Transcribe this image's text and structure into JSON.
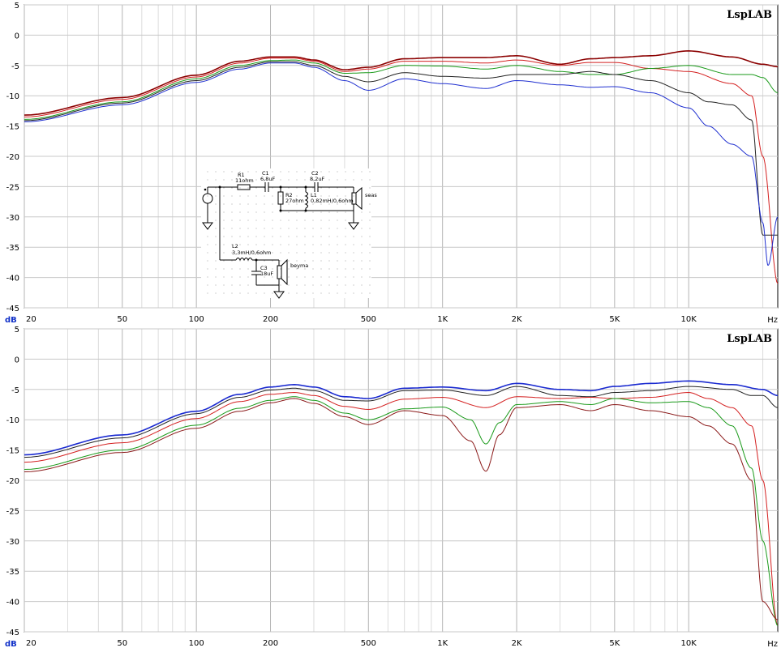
{
  "chart_data": [
    {
      "type": "line",
      "title": "LspLAB",
      "xlabel": "Hz",
      "ylabel": "dB",
      "xscale": "log",
      "xlim": [
        20,
        23000
      ],
      "ylim": [
        -45,
        5
      ],
      "x_ticks": [
        20,
        50,
        100,
        200,
        500,
        1000,
        2000,
        5000,
        10000
      ],
      "x_tick_labels": [
        "20",
        "50",
        "100",
        "200",
        "500",
        "1K",
        "2K",
        "5K",
        "10K"
      ],
      "y_ticks": [
        5,
        0,
        -5,
        -10,
        -15,
        -20,
        -25,
        -30,
        -35,
        -40,
        -45
      ],
      "grid": true,
      "series": [
        {
          "color": "#8b0000",
          "x": [
            20,
            50,
            100,
            150,
            200,
            250,
            300,
            400,
            500,
            700,
            1000,
            1500,
            2000,
            3000,
            4000,
            5000,
            7000,
            10000,
            15000,
            20000,
            23000
          ],
          "y": [
            -13.2,
            -10.3,
            -6.6,
            -4.3,
            -3.6,
            -3.6,
            -4.1,
            -5.7,
            -5.3,
            -3.9,
            -3.7,
            -3.7,
            -3.4,
            -4.8,
            -3.9,
            -3.7,
            -3.4,
            -2.6,
            -3.6,
            -4.8,
            -5.2
          ]
        },
        {
          "color": "#d42020",
          "x": [
            20,
            50,
            100,
            150,
            200,
            250,
            300,
            400,
            500,
            700,
            1000,
            1500,
            2000,
            3000,
            4000,
            5000,
            7000,
            10000,
            15000,
            18000,
            20000,
            23000
          ],
          "y": [
            -13.5,
            -10.6,
            -6.9,
            -4.6,
            -3.8,
            -3.8,
            -4.3,
            -6.0,
            -5.6,
            -4.3,
            -4.3,
            -4.6,
            -4.1,
            -5.0,
            -4.5,
            -4.5,
            -5.5,
            -6.0,
            -8.0,
            -10.0,
            -20.0,
            -41.0
          ]
        },
        {
          "color": "#1a9a1a",
          "x": [
            20,
            50,
            100,
            150,
            200,
            250,
            300,
            400,
            500,
            700,
            1000,
            1500,
            2000,
            3000,
            4000,
            5000,
            7000,
            10000,
            15000,
            18000,
            20000,
            23000
          ],
          "y": [
            -13.9,
            -11.0,
            -7.2,
            -5.0,
            -4.2,
            -4.1,
            -4.6,
            -6.3,
            -6.2,
            -5.0,
            -5.1,
            -5.6,
            -5.0,
            -6.0,
            -6.5,
            -6.5,
            -5.5,
            -5.0,
            -6.5,
            -6.5,
            -7.0,
            -9.5
          ]
        },
        {
          "color": "#222222",
          "x": [
            20,
            50,
            100,
            150,
            200,
            250,
            300,
            400,
            500,
            700,
            1000,
            1500,
            2000,
            3000,
            4000,
            5000,
            7000,
            10000,
            12000,
            15000,
            18000,
            20000,
            23000
          ],
          "y": [
            -14.1,
            -11.2,
            -7.5,
            -5.3,
            -4.4,
            -4.4,
            -5.0,
            -6.8,
            -7.7,
            -6.2,
            -6.8,
            -7.1,
            -6.5,
            -6.5,
            -6.0,
            -6.5,
            -7.5,
            -9.5,
            -11.0,
            -11.5,
            -14.0,
            -33.0,
            -33.0
          ]
        },
        {
          "color": "#2030d0",
          "x": [
            20,
            50,
            100,
            150,
            200,
            250,
            300,
            400,
            500,
            700,
            1000,
            1500,
            2000,
            3000,
            4000,
            5000,
            7000,
            10000,
            12000,
            15000,
            18000,
            20000,
            21000,
            23000
          ],
          "y": [
            -14.3,
            -11.5,
            -7.8,
            -5.6,
            -4.6,
            -4.6,
            -5.3,
            -7.5,
            -9.1,
            -7.2,
            -8.0,
            -8.8,
            -7.5,
            -8.2,
            -8.6,
            -8.5,
            -9.5,
            -12.0,
            -15.0,
            -18.0,
            -20.0,
            -31.0,
            -38.0,
            -30.0
          ]
        }
      ]
    },
    {
      "type": "line",
      "title": "LspLAB",
      "xlabel": "Hz",
      "ylabel": "dB",
      "xscale": "log",
      "xlim": [
        20,
        23000
      ],
      "ylim": [
        -45,
        5
      ],
      "x_ticks": [
        20,
        50,
        100,
        200,
        500,
        1000,
        2000,
        5000,
        10000
      ],
      "x_tick_labels": [
        "20",
        "50",
        "100",
        "200",
        "500",
        "1K",
        "2K",
        "5K",
        "10K"
      ],
      "y_ticks": [
        5,
        0,
        -5,
        -10,
        -15,
        -20,
        -25,
        -30,
        -35,
        -40,
        -45
      ],
      "grid": true,
      "series": [
        {
          "color": "#1a2ad0",
          "x": [
            20,
            50,
            100,
            150,
            200,
            250,
            300,
            400,
            500,
            700,
            1000,
            1500,
            2000,
            3000,
            4000,
            5000,
            7000,
            10000,
            15000,
            20000,
            23000
          ],
          "y": [
            -15.8,
            -12.5,
            -8.6,
            -5.8,
            -4.6,
            -4.2,
            -4.6,
            -6.2,
            -6.5,
            -4.8,
            -4.6,
            -5.2,
            -4.0,
            -5.0,
            -5.2,
            -4.5,
            -4.0,
            -3.6,
            -4.2,
            -5.0,
            -6.0
          ]
        },
        {
          "color": "#222222",
          "x": [
            20,
            50,
            100,
            150,
            200,
            250,
            300,
            400,
            500,
            700,
            1000,
            1500,
            2000,
            3000,
            4000,
            5000,
            7000,
            10000,
            15000,
            18000,
            20000,
            23000
          ],
          "y": [
            -16.2,
            -13.0,
            -9.0,
            -6.3,
            -5.1,
            -4.8,
            -5.2,
            -6.8,
            -6.9,
            -5.2,
            -5.1,
            -6.0,
            -4.5,
            -6.0,
            -6.2,
            -5.5,
            -5.2,
            -4.5,
            -5.0,
            -6.0,
            -6.0,
            -8.0
          ]
        },
        {
          "color": "#d42020",
          "x": [
            20,
            50,
            100,
            150,
            200,
            250,
            300,
            400,
            500,
            700,
            1000,
            1500,
            2000,
            3000,
            4000,
            5000,
            7000,
            10000,
            12000,
            15000,
            18000,
            20000,
            23000
          ],
          "y": [
            -17.0,
            -13.8,
            -9.8,
            -7.0,
            -5.8,
            -5.5,
            -6.0,
            -7.8,
            -8.3,
            -6.6,
            -6.3,
            -8.0,
            -6.2,
            -6.5,
            -6.3,
            -6.5,
            -6.3,
            -5.5,
            -6.5,
            -8.0,
            -11.0,
            -20.0,
            -44.0
          ]
        },
        {
          "color": "#1a9a1a",
          "x": [
            20,
            50,
            100,
            150,
            200,
            250,
            300,
            400,
            500,
            700,
            1000,
            1300,
            1500,
            1700,
            2000,
            3000,
            4000,
            5000,
            7000,
            10000,
            12000,
            15000,
            18000,
            20000,
            23000
          ],
          "y": [
            -18.2,
            -15.0,
            -10.9,
            -8.1,
            -6.8,
            -6.2,
            -6.8,
            -8.9,
            -10.0,
            -8.2,
            -7.9,
            -10.0,
            -14.0,
            -10.5,
            -7.5,
            -7.0,
            -7.5,
            -6.5,
            -7.2,
            -7.0,
            -8.0,
            -11.0,
            -18.0,
            -30.0,
            -44.0
          ]
        },
        {
          "color": "#8b1a1a",
          "x": [
            20,
            50,
            100,
            150,
            200,
            250,
            300,
            400,
            500,
            700,
            1000,
            1300,
            1500,
            1700,
            2000,
            3000,
            4000,
            5000,
            7000,
            10000,
            12000,
            15000,
            18000,
            20000,
            23000
          ],
          "y": [
            -18.6,
            -15.4,
            -11.4,
            -8.6,
            -7.2,
            -6.5,
            -7.3,
            -9.5,
            -10.8,
            -8.5,
            -9.3,
            -13.5,
            -18.5,
            -12.5,
            -8.0,
            -7.5,
            -8.5,
            -7.5,
            -8.5,
            -9.5,
            -11.0,
            -14.0,
            -20.0,
            -40.0,
            -43.0
          ]
        }
      ]
    }
  ],
  "schematic": {
    "r1": {
      "name": "R1",
      "value": "11ohm"
    },
    "c1": {
      "name": "C1",
      "value": "6,8uF"
    },
    "c2": {
      "name": "C2",
      "value": "8,2uF"
    },
    "r2": {
      "name": "R2",
      "value": "27ohm"
    },
    "l1": {
      "name": "L1",
      "value": "0,82mH/0,6ohm"
    },
    "l2": {
      "name": "L2",
      "value": "3,3mH/0,6ohm"
    },
    "c3": {
      "name": "C3",
      "value": "18uF"
    },
    "tweeter": "seas",
    "woofer": "beyma"
  }
}
